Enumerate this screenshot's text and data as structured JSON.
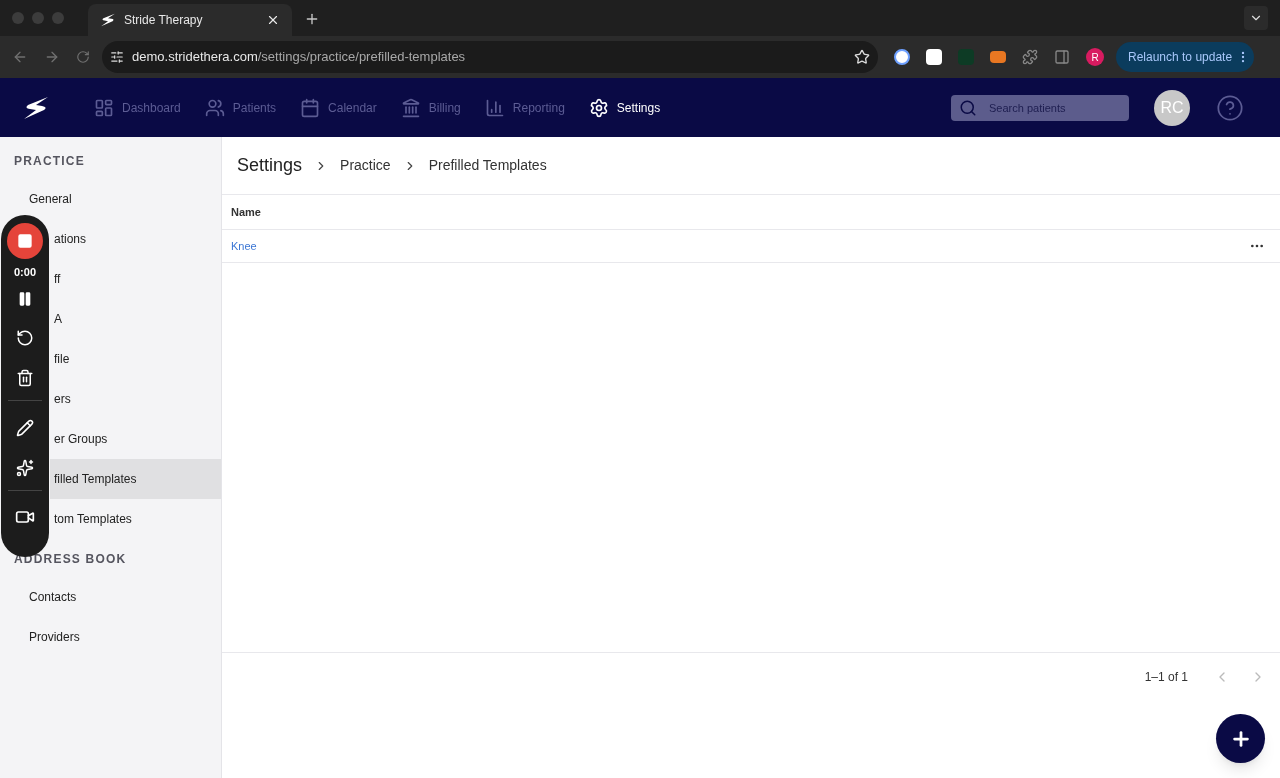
{
  "browser": {
    "tab_title": "Stride Therapy",
    "url_host": "demo.stridethera.com",
    "url_path": "/settings/practice/prefilled-templates",
    "profile_initial": "R",
    "update_button": "Relaunch to update"
  },
  "nav": {
    "items": [
      {
        "label": "Dashboard",
        "kind": "dashboard",
        "selected": false
      },
      {
        "label": "Patients",
        "kind": "patients",
        "selected": false
      },
      {
        "label": "Calendar",
        "kind": "calendar",
        "selected": false
      },
      {
        "label": "Billing",
        "kind": "billing",
        "selected": false
      },
      {
        "label": "Reporting",
        "kind": "reporting",
        "selected": false
      },
      {
        "label": "Settings",
        "kind": "settings",
        "selected": true
      }
    ],
    "search_placeholder": "Search patients",
    "avatar": "RC"
  },
  "sidebar": {
    "sections": [
      {
        "title": "PRACTICE",
        "items": [
          {
            "label": "General",
            "covered": false,
            "selected": false
          },
          {
            "label": "ations",
            "covered": true,
            "selected": false
          },
          {
            "label": "ff",
            "covered": true,
            "selected": false
          },
          {
            "label": "A",
            "covered": true,
            "selected": false
          },
          {
            "label": "file",
            "covered": true,
            "selected": false
          },
          {
            "label": "ers",
            "covered": true,
            "selected": false
          },
          {
            "label": "er Groups",
            "covered": true,
            "selected": false
          },
          {
            "label": "filled Templates",
            "covered": true,
            "selected": true
          },
          {
            "label": "tom Templates",
            "covered": true,
            "selected": false
          }
        ]
      },
      {
        "title": "ADDRESS BOOK",
        "items": [
          {
            "label": "Contacts",
            "covered": false,
            "selected": false
          },
          {
            "label": "Providers",
            "covered": false,
            "selected": false
          }
        ]
      }
    ]
  },
  "breadcrumb": [
    "Settings",
    "Practice",
    "Prefilled Templates"
  ],
  "table": {
    "columns": [
      "Name"
    ],
    "rows": [
      {
        "name": "Knee"
      }
    ]
  },
  "pagination": "1–1 of 1",
  "recorder": {
    "time": "0:00"
  }
}
